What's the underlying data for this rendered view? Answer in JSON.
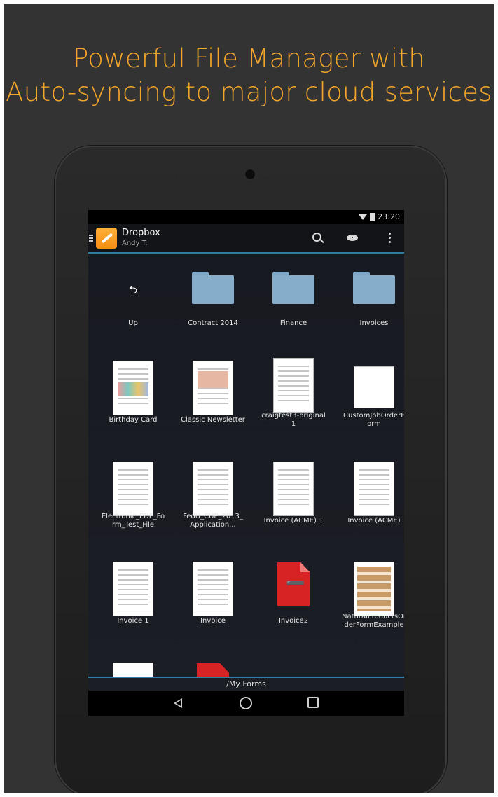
{
  "promo": {
    "headline_line1": "Powerful File Manager with",
    "headline_line2": "Auto-syncing to major cloud services"
  },
  "status_bar": {
    "time": "23:20"
  },
  "action_bar": {
    "title": "Dropbox",
    "subtitle": "Andy T.",
    "icons": [
      "menu-icon",
      "app-icon",
      "search-icon",
      "eye-icon",
      "overflow-icon"
    ]
  },
  "files": [
    {
      "label": "Up",
      "type": "up"
    },
    {
      "label": "Contract 2014",
      "type": "folder"
    },
    {
      "label": "Finance",
      "type": "folder"
    },
    {
      "label": "Invoices",
      "type": "folder"
    },
    {
      "label": "Birthday Card",
      "type": "document"
    },
    {
      "label": "Classic Newsletter",
      "type": "document"
    },
    {
      "label": "craigtest3-original\n1",
      "type": "document"
    },
    {
      "label": "CustomJobOrderF\norm",
      "type": "document"
    },
    {
      "label": "Electronic_PDF_Fo\nrm_Test_File",
      "type": "document"
    },
    {
      "label": "FedU_CUP_2013_\nApplication...",
      "type": "document"
    },
    {
      "label": "Invoice (ACME) 1",
      "type": "document"
    },
    {
      "label": "Invoice (ACME)",
      "type": "document"
    },
    {
      "label": "Invoice 1",
      "type": "document"
    },
    {
      "label": "Invoice",
      "type": "document"
    },
    {
      "label": "Invoice2",
      "type": "pdf"
    },
    {
      "label": "NaturalProductsOr\nderFormExample",
      "type": "document"
    }
  ],
  "path_bar": {
    "path": "/My Forms"
  },
  "nav_bar": {
    "icons": [
      "back-icon",
      "home-icon",
      "recents-icon"
    ]
  },
  "colors": {
    "accent": "#f3a52a",
    "divider": "#2f7fa3",
    "folder": "#86aecb",
    "pdf": "#d72323"
  }
}
